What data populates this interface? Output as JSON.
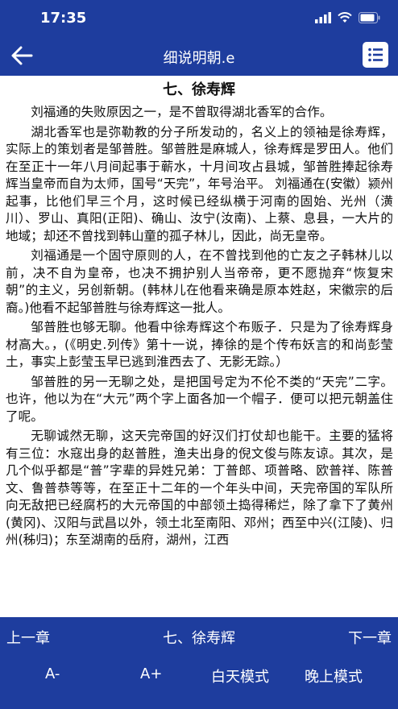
{
  "status_bar": {
    "time": "17:35"
  },
  "navbar": {
    "title": "细说明朝.e",
    "back_icon": "arrow-left-icon",
    "menu_icon": "list-icon"
  },
  "content": {
    "chapter_title": "七、徐寿辉",
    "paragraphs": [
      "刘福通的失败原因之一，是不曾取得湖北香军的合作。",
      "湖北香军也是弥勒教的分子所发动的，名义上的领袖是徐寿辉，实际上的策划者是邹普胜。邹普胜是麻城人，徐寿辉是罗田人。他们在至正十一年八月间起事于蕲水，十月间攻占县城，邹普胜捧起徐寿辉当皇帝而自为太师，国号“天完”，年号治平。 刘福通在(安徽）颍州起事，比他们早三个月，这时候已经纵横于河南的固始、光州（潢川）、罗山、真阳(正阳)、确山、汝宁(汝南)、上蔡、息县，一大片的地域；却还不曾找到韩山童的孤子林儿，因此，尚无皇帝。",
      "刘福通是一个固守原则的人，在不曾找到他的亡友之子韩林儿以前，决不自为皇帝，也决不拥护别人当帝帝，更不愿抛弃“恢复宋朝”的主义，另创新朝。(韩林儿在他看来确是原本姓赵，宋徽宗的后裔。)他看不起邹普胜与徐寿辉这一批人。",
      "邹普胜也够无聊。他看中徐寿辉这个布贩子．只是为了徐寿辉身材高大。，(《明史.列传》第十一说，捧徐的是个传布妖言的和尚彭莹土，事实上彭莹玉早已逃到淮西去了、无影无踪。）",
      "邹普胜的另一无聊之处，是把国号定为不伦不类的“天完”二字。也许，他以为在“大元”两个字上面各加一个帽子．便可以把元朝盖住了呢。",
      "无聊诚然无聊，这天完帝国的好汉们打仗却也能干。主要的猛将有三位：水寇出身的赵普胜，渔夫出身的倪文俊与陈友谅。其次，是几个似乎都是“普”字辈的异姓兄弟：丁普郎、项普略、欧普祥、陈普文、鲁普恭等等，在至正十二年的一个年头中间，天完帝国的军队所向无敌把已经腐朽的大元帝国的中部领土捣得稀烂，除了拿下了黄州(黄冈)、汉阳与武昌以外，领土北至南阳、邓州；西至中兴(江陵)、归州(秭归)；东至湖南的岳府，湖州，江西"
    ]
  },
  "bottom_bar": {
    "prev_label": "上一章",
    "current_chapter": "七、徐寿辉",
    "next_label": "下一章",
    "font_decrease": "A-",
    "font_increase": "A+",
    "day_mode": "白天模式",
    "night_mode": "晚上模式"
  },
  "colors": {
    "bar": "#1e3d9e",
    "text": "#111111",
    "background": "#ffffff"
  }
}
